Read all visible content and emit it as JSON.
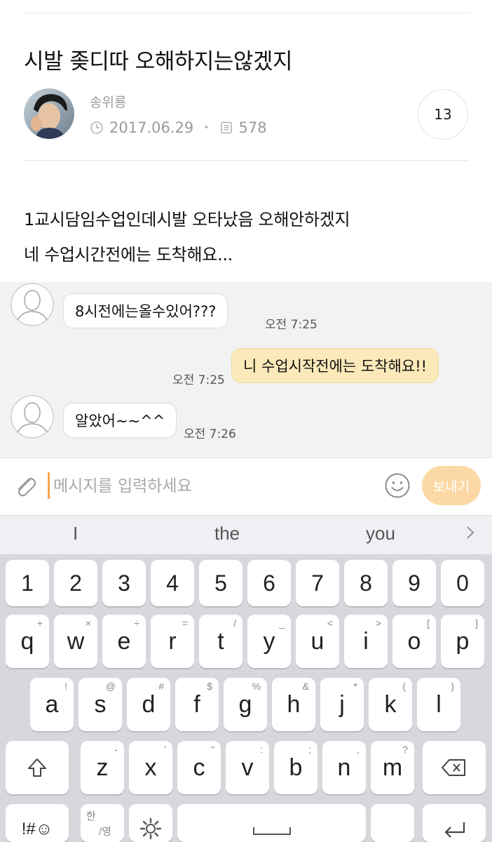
{
  "post": {
    "title": "시발 좆디따 오해하지는않겠지",
    "author": "송위룡",
    "date": "2017.06.29",
    "views": "578",
    "comments": "13",
    "body_line1": "1교시담임수업인데시발 오타났음 오해안하겠지",
    "body_line2": "네 수업시간전에는 도착해요..."
  },
  "chat": {
    "messages": [
      {
        "side": "in",
        "text": "8시전에는올수있어???",
        "time": "오전 7:25"
      },
      {
        "side": "out",
        "text": "니 수업시작전에는 도착해요!!",
        "time": "오전 7:25"
      },
      {
        "side": "in",
        "text": "알았어~~^^",
        "time": "오전 7:26"
      }
    ]
  },
  "composer": {
    "placeholder": "메시지를 입력하세요",
    "send_label": "보내기",
    "accent": "#f5a54a",
    "send_color": "#fcd9a4"
  },
  "suggestions": [
    "I",
    "the",
    "you"
  ],
  "keyboard": {
    "numbers": [
      "1",
      "2",
      "3",
      "4",
      "5",
      "6",
      "7",
      "8",
      "9",
      "0"
    ],
    "row1": [
      {
        "k": "q",
        "s": "+"
      },
      {
        "k": "w",
        "s": "×"
      },
      {
        "k": "e",
        "s": "÷"
      },
      {
        "k": "r",
        "s": "="
      },
      {
        "k": "t",
        "s": "/"
      },
      {
        "k": "y",
        "s": "_"
      },
      {
        "k": "u",
        "s": "<"
      },
      {
        "k": "i",
        "s": ">"
      },
      {
        "k": "o",
        "s": "["
      },
      {
        "k": "p",
        "s": "]"
      }
    ],
    "row2": [
      {
        "k": "a",
        "s": "!"
      },
      {
        "k": "s",
        "s": "@"
      },
      {
        "k": "d",
        "s": "#"
      },
      {
        "k": "f",
        "s": "$"
      },
      {
        "k": "g",
        "s": "%"
      },
      {
        "k": "h",
        "s": "&"
      },
      {
        "k": "j",
        "s": "*"
      },
      {
        "k": "k",
        "s": "("
      },
      {
        "k": "l",
        "s": ")"
      }
    ],
    "row3": [
      {
        "k": "z",
        "s": "-"
      },
      {
        "k": "x",
        "s": "'"
      },
      {
        "k": "c",
        "s": "\""
      },
      {
        "k": "v",
        "s": ":"
      },
      {
        "k": "b",
        "s": ";"
      },
      {
        "k": "n",
        "s": ","
      },
      {
        "k": "m",
        "s": "?"
      }
    ],
    "symbols_label": "!#☺",
    "lang_label_top": "한",
    "lang_label_bottom": "/영"
  }
}
